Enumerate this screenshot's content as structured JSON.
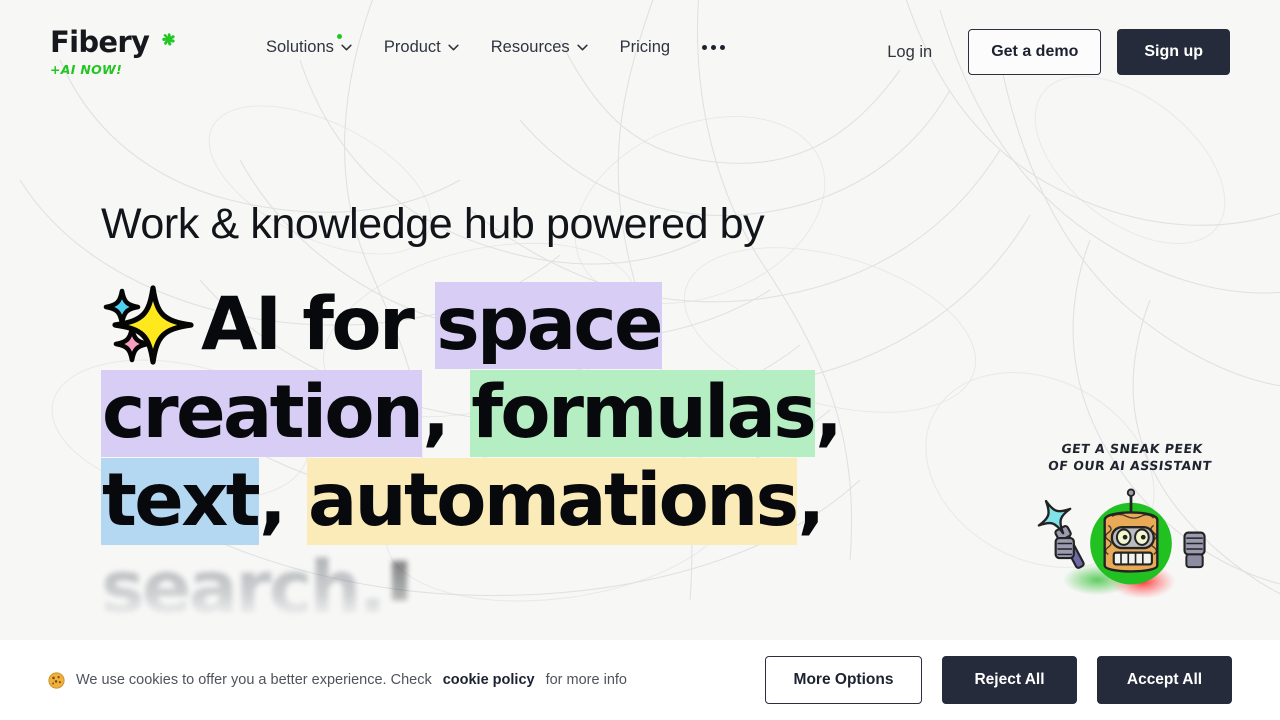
{
  "brand": {
    "name": "Fibery",
    "mark_icon": "clover-icon",
    "tagline": "+AI NOW!"
  },
  "nav": {
    "items": [
      {
        "label": "Solutions",
        "has_caret": true,
        "has_dot": true
      },
      {
        "label": "Product",
        "has_caret": true,
        "has_dot": false
      },
      {
        "label": "Resources",
        "has_caret": true,
        "has_dot": false
      },
      {
        "label": "Pricing",
        "has_caret": false,
        "has_dot": false
      }
    ],
    "more_icon": "ellipsis-icon",
    "login_label": "Log in",
    "demo_label": "Get a demo",
    "signup_label": "Sign up"
  },
  "hero": {
    "line1": "Work & knowledge hub powered by",
    "sparkle_icon": "sparkles-icon",
    "seg_ai_for": "AI for ",
    "seg_space": "space",
    "seg_creation": "creation",
    "comma_1": ", ",
    "seg_formulas": "formulas",
    "comma_2": ", ",
    "seg_text": "text",
    "comma_3": ", ",
    "seg_automations": "automations",
    "comma_4": ",",
    "fading_line": "search.",
    "highlight_colors": {
      "space": "#d8cdf5",
      "creation": "#d8cdf5",
      "formulas": "#b5eec2",
      "text": "#b5d8f2",
      "automations": "#fbebb9"
    }
  },
  "mascot": {
    "caption": "GET A SNEAK PEEK\nOF OUR AI ASSISTANT",
    "art_icon": "robot-assistant-icon"
  },
  "cookie": {
    "icon": "cookie-icon",
    "message_before": "We use cookies to offer you a better experience. Check ",
    "link_label": "cookie policy",
    "message_after": " for more info",
    "more_options_label": "More Options",
    "reject_label": "Reject All",
    "accept_label": "Accept All"
  },
  "colors": {
    "page_bg": "#f7f7f6",
    "dark": "#252b3b",
    "brand_green": "#22c522",
    "banner_bg": "#ffffff"
  }
}
